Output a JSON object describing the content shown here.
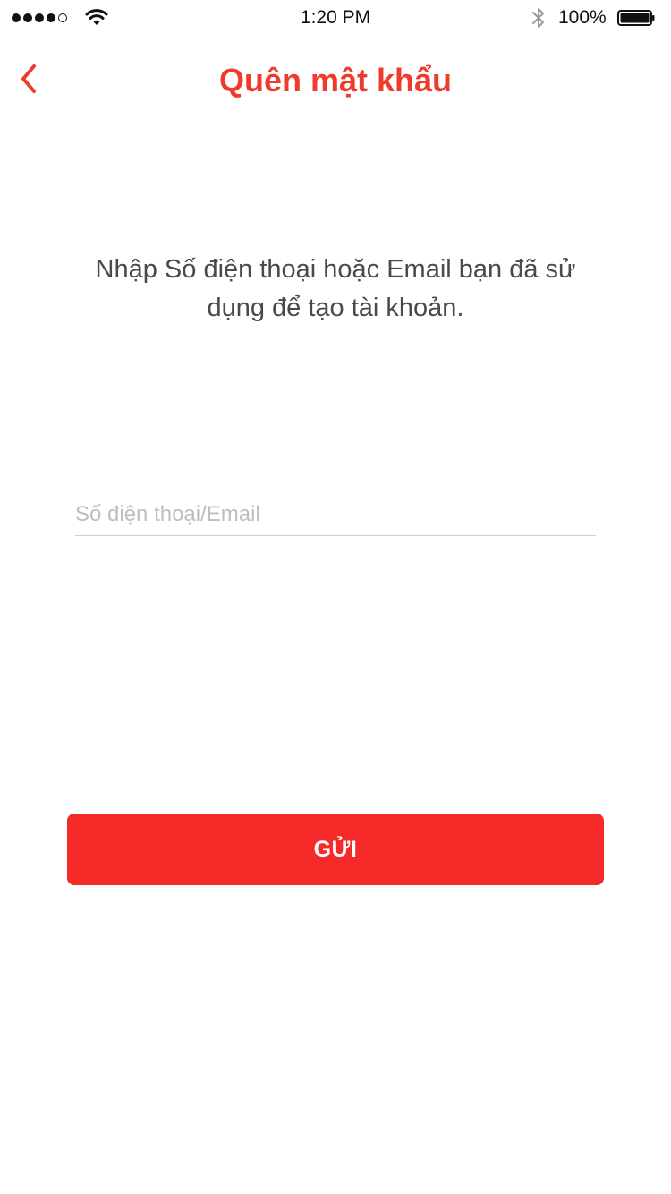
{
  "status_bar": {
    "time": "1:20 PM",
    "battery_percent": "100%",
    "signal_bars_filled": 4,
    "signal_bars_total": 5,
    "icons": [
      "signal-dots-icon",
      "wifi-icon",
      "bluetooth-icon",
      "battery-icon"
    ]
  },
  "nav": {
    "back_icon": "chevron-left-icon",
    "title": "Quên mật khẩu"
  },
  "instruction": "Nhập Số điện thoại hoặc Email bạn đã sử dụng để tạo tài khoản.",
  "form": {
    "contact_value": "",
    "contact_placeholder": "Số điện thoại/Email",
    "submit_label": "GỬI"
  },
  "colors": {
    "accent": "#ef3b2c",
    "button_bg": "#f72a2a",
    "text": "#4a4a4a",
    "placeholder": "#bdbdbd",
    "divider": "#cfcfcf"
  }
}
